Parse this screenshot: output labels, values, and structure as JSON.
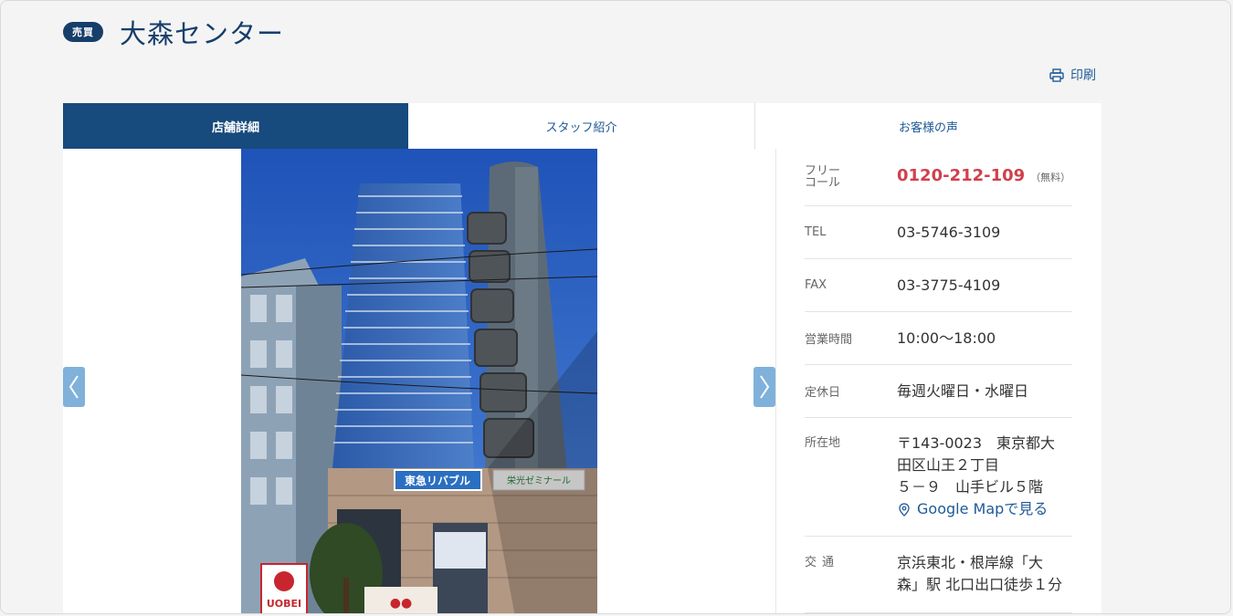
{
  "header": {
    "badge": "売買",
    "title": "大森センター"
  },
  "print_label": "印刷",
  "tabs": [
    {
      "label": "店舗詳細",
      "active": true
    },
    {
      "label": "スタッフ紹介",
      "active": false
    },
    {
      "label": "お客様の声",
      "active": false
    }
  ],
  "info": {
    "free": {
      "label_line1": "フリー",
      "label_line2": "コール",
      "number": "0120-212-109",
      "note": "（無料）"
    },
    "tel": {
      "label": "TEL",
      "value": "03-5746-3109"
    },
    "fax": {
      "label": "FAX",
      "value": "03-3775-4109"
    },
    "hours": {
      "label": "営業時間",
      "value": "10:00～18:00"
    },
    "closed": {
      "label": "定休日",
      "value": "毎週火曜日・水曜日"
    },
    "address": {
      "label": "所在地",
      "line1": "〒143-0023　東京都大",
      "line2": "田区山王２丁目",
      "line3": "５－９　山手ビル５階",
      "map_link": "Google Mapで見る"
    },
    "access": {
      "label": "交通",
      "line1": "京浜東北・根岸線「大",
      "line2": "森」駅 北口出口徒歩１分"
    }
  },
  "photo": {
    "signs": [
      "東急リバブル",
      "栄光ゼミナール",
      "UOBEI"
    ]
  },
  "colors": {
    "brand_navy": "#163e6b",
    "tab_active": "#174a7d",
    "link_blue": "#1e5a96",
    "freecall_red": "#d0404d",
    "arrow_blue": "#7fb1da"
  }
}
